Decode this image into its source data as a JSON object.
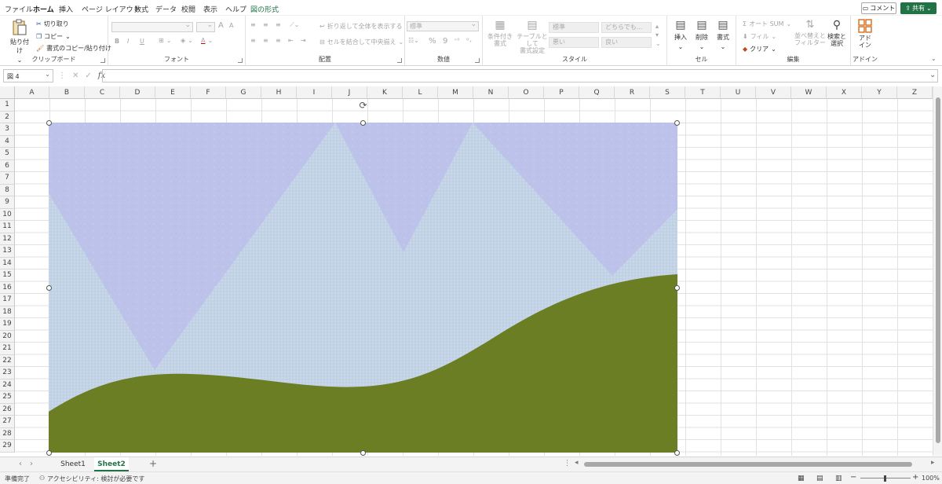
{
  "menu": {
    "tabs": [
      "ファイル",
      "ホーム",
      "挿入",
      "ページ レイアウト",
      "数式",
      "データ",
      "校閲",
      "表示",
      "ヘルプ",
      "図の形式"
    ],
    "active": "ホーム",
    "comment_label": "コメント",
    "share_label": "共有"
  },
  "ribbon": {
    "clipboard": {
      "label": "クリップボード",
      "paste": "貼り付け",
      "cut": "切り取り",
      "copy": "コピー",
      "format_painter": "書式のコピー/貼り付け"
    },
    "font": {
      "label": "フォント",
      "bold": "B",
      "italic": "I",
      "underline": "U",
      "grow": "A",
      "shrink": "A"
    },
    "alignment": {
      "label": "配置",
      "wrap_text": "折り返して全体を表示する",
      "merge_center": "セルを結合して中央揃え"
    },
    "number": {
      "label": "数値",
      "format": "標準",
      "percent": "%",
      "comma": "9"
    },
    "styles": {
      "label": "スタイル",
      "conditional": "条件付き\n書式",
      "as_table": "テーブルとして\n書式設定",
      "cell_normal": "標準",
      "cell_neutral": "どちらでも...",
      "cell_bad": "悪い",
      "cell_good": "良い"
    },
    "cells": {
      "label": "セル",
      "insert": "挿入",
      "delete": "削除",
      "format": "書式"
    },
    "editing": {
      "label": "編集",
      "autosum": "オート SUM",
      "fill": "フィル",
      "clear": "クリア",
      "sort_filter": "並べ替えと\nフィルター",
      "find_select": "検索と\n選択"
    },
    "addins": {
      "label": "アドイン",
      "addins": "アド\nイン"
    }
  },
  "formula_bar": {
    "name_box": "図 4",
    "fx": "fx",
    "formula": ""
  },
  "grid": {
    "columns": [
      "A",
      "B",
      "C",
      "D",
      "E",
      "F",
      "G",
      "H",
      "I",
      "J",
      "K",
      "L",
      "M",
      "N",
      "O",
      "P",
      "Q",
      "R",
      "S",
      "T",
      "U",
      "V",
      "W",
      "X",
      "Y",
      "Z"
    ],
    "rows": [
      "1",
      "2",
      "3",
      "4",
      "5",
      "6",
      "7",
      "8",
      "9",
      "10",
      "11",
      "12",
      "13",
      "14",
      "15",
      "16",
      "17",
      "18",
      "19",
      "20",
      "21",
      "22",
      "23",
      "24",
      "25",
      "26",
      "27",
      "28",
      "29"
    ]
  },
  "picture": {
    "sky_color": "#bcc2ea",
    "mountain_color": "#c3d3e6",
    "hill_color": "#6b7e23"
  },
  "sheets": {
    "tabs": [
      "Sheet1",
      "Sheet2"
    ],
    "active": "Sheet2"
  },
  "status": {
    "ready": "準備完了",
    "accessibility": "アクセシビリティ: 検討が必要です",
    "zoom": "100%"
  }
}
